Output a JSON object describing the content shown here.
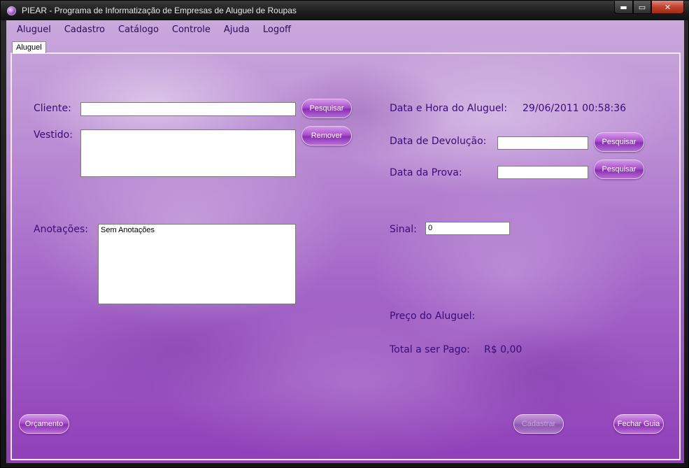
{
  "window": {
    "title": "PIEAR - Programa de Informatização de Empresas de Aluguel de Roupas",
    "controls": {
      "minimize": "▬",
      "maximize": "▭",
      "close": "✕"
    }
  },
  "menu": [
    "Aluguel",
    "Cadastro",
    "Catálogo",
    "Controle",
    "Ajuda",
    "Logoff"
  ],
  "tab": {
    "label": "Aluguel"
  },
  "form": {
    "cliente": {
      "label": "Cliente:",
      "value": "",
      "button": "Pesquisar"
    },
    "vestido": {
      "label": "Vestido:",
      "value": "",
      "button": "Remover"
    },
    "anotacoes": {
      "label": "Anotações:",
      "value": "Sem Anotações"
    },
    "data_hora": {
      "label": "Data e Hora do Aluguel:",
      "value": "29/06/2011 00:58:36"
    },
    "data_devolucao": {
      "label": "Data de Devolução:",
      "value": "",
      "button": "Pesquisar"
    },
    "data_prova": {
      "label": "Data da Prova:",
      "value": "",
      "button": "Pesquisar"
    },
    "sinal": {
      "label": "Sinal:",
      "value": "0"
    },
    "preco": {
      "label": "Preço do Aluguel:"
    },
    "total": {
      "label": "Total a ser Pago:",
      "value": "R$ 0,00"
    }
  },
  "actions": {
    "orcamento": "Orçamento",
    "cadastrar": "Cadastrar",
    "fechar_guia": "Fechar Guia"
  },
  "colors": {
    "accent": "#a94fcc",
    "label": "#3a0a78",
    "background": "#b98bd3"
  }
}
